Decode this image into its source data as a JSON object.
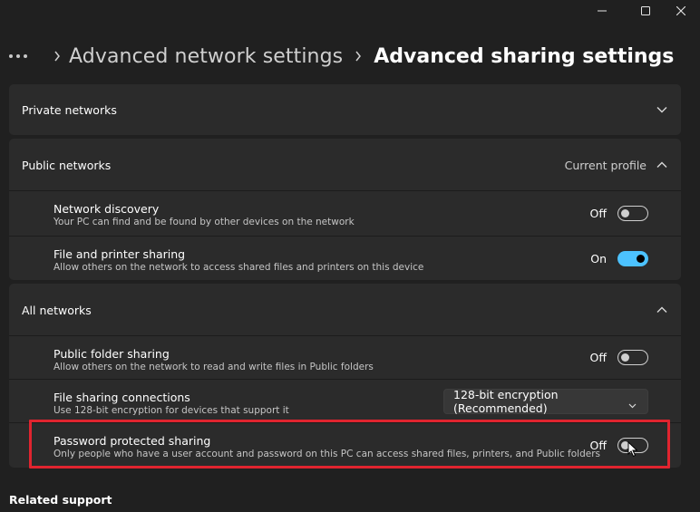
{
  "window": {
    "controls": [
      {
        "icon": "minimize-icon"
      },
      {
        "icon": "maximize-icon"
      },
      {
        "icon": "close-icon"
      }
    ]
  },
  "breadcrumb": {
    "more_icon": "more-dots-icon",
    "parent": "Advanced network settings",
    "current": "Advanced sharing settings"
  },
  "sections": {
    "private": {
      "label": "Private networks",
      "expanded": false
    },
    "public": {
      "label": "Public networks",
      "note": "Current profile",
      "expanded": true,
      "rows": [
        {
          "title": "Network discovery",
          "subtitle": "Your PC can find and be found by other devices on the network",
          "state": "Off",
          "on": false
        },
        {
          "title": "File and printer sharing",
          "subtitle": "Allow others on the network to access shared files and printers on this device",
          "state": "On",
          "on": true
        }
      ]
    },
    "all": {
      "label": "All networks",
      "expanded": true,
      "rows": [
        {
          "title": "Public folder sharing",
          "subtitle": "Allow others on the network to read and write files in Public folders",
          "state": "Off",
          "on": false
        },
        {
          "title": "File sharing connections",
          "subtitle": "Use 128-bit encryption for devices that support it",
          "dropdown_value": "128-bit encryption (Recommended)"
        },
        {
          "title": "Password protected sharing",
          "subtitle": "Only people who have a user account and password on this PC can access shared files, printers, and Public folders",
          "state": "Off",
          "on": false
        }
      ]
    }
  },
  "related_support": "Related support",
  "colors": {
    "background": "#202020",
    "card": "#2b2b2b",
    "accent": "#4cc2ff",
    "highlight": "#e0242f"
  }
}
